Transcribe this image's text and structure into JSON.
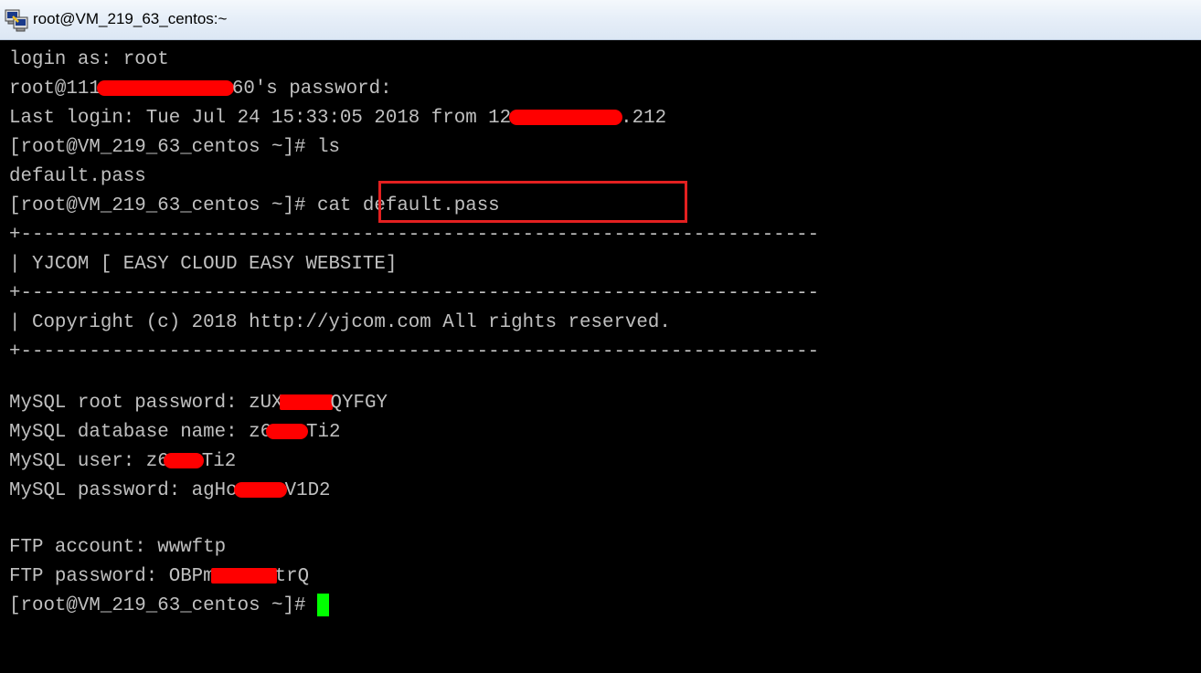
{
  "window": {
    "title": "root@VM_219_63_centos:~",
    "icon": "putty-icon"
  },
  "terminal": {
    "lines": [
      {
        "parts": [
          "login as: root"
        ]
      },
      {
        "parts": [
          "root@111",
          "60's password:"
        ]
      },
      {
        "parts": [
          "Last login: Tue Jul 24 15:33:05 2018 from 12",
          ".212"
        ]
      },
      {
        "parts": [
          "[root@VM_219_63_centos ~]# ls"
        ]
      },
      {
        "parts": [
          "default.pass"
        ]
      },
      {
        "parts": [
          "[root@VM_219_63_centos ~]# ",
          "cat default.pass"
        ]
      },
      {
        "parts": [
          "+----------------------------------------------------------------------"
        ]
      },
      {
        "parts": [
          "| YJCOM [ EASY CLOUD EASY WEBSITE]"
        ]
      },
      {
        "parts": [
          "+----------------------------------------------------------------------"
        ]
      },
      {
        "parts": [
          "| Copyright (c) 2018 http://yjcom.com All rights reserved."
        ]
      },
      {
        "parts": [
          "+----------------------------------------------------------------------"
        ]
      },
      {
        "parts": [
          ""
        ]
      },
      {
        "parts": [
          "MySQL root password: zUX",
          "QYFGY"
        ]
      },
      {
        "parts": [
          "MySQL database name: z6",
          "Ti2"
        ]
      },
      {
        "parts": [
          "MySQL user: z6",
          "Ti2"
        ]
      },
      {
        "parts": [
          "MySQL password: agHo",
          "V1D2"
        ]
      },
      {
        "parts": [
          ""
        ]
      },
      {
        "parts": [
          "FTP account: wwwftp"
        ]
      },
      {
        "parts": [
          "FTP password: OBPm",
          "trQ"
        ]
      },
      {
        "parts": [
          "[root@VM_219_63_centos ~]# "
        ]
      }
    ],
    "highlighted_command": "cat default.pass",
    "colors": {
      "background": "#000000",
      "foreground": "#c0c0c0",
      "cursor": "#00ff00",
      "redaction": "#ff0000",
      "highlight_box": "#e32020"
    }
  }
}
